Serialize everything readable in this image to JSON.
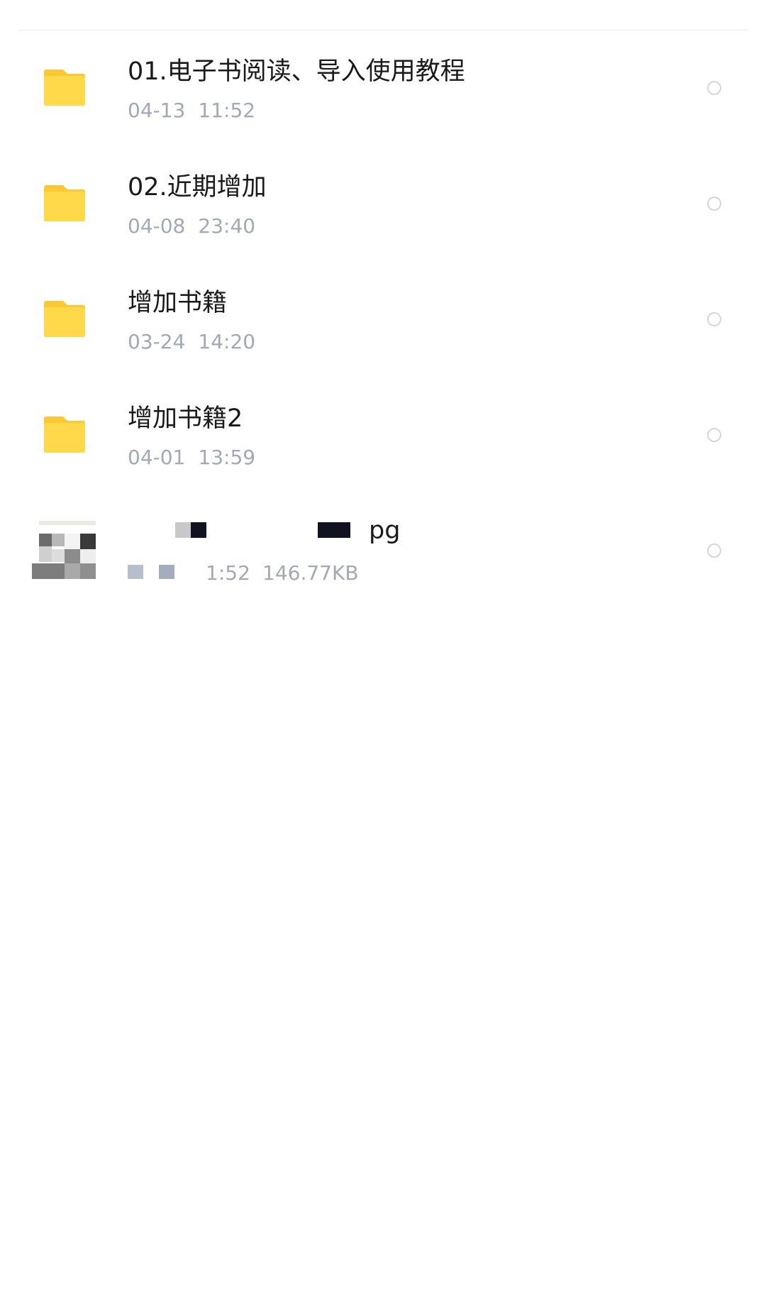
{
  "colors": {
    "folder": "#FFD94A",
    "folder_tab": "#F9C834",
    "name_text": "#1a1a1a",
    "meta_text": "#a3a8b2",
    "radio_border": "#d6d6d6"
  },
  "files": [
    {
      "type": "folder",
      "icon": "folder-icon",
      "name": "01.电子书阅读、导入使用教程",
      "date": "04-13",
      "time": "11:52",
      "size": ""
    },
    {
      "type": "folder",
      "icon": "folder-icon",
      "name": "02.近期增加",
      "date": "04-08",
      "time": "23:40",
      "size": ""
    },
    {
      "type": "folder",
      "icon": "folder-icon",
      "name": "增加书籍",
      "date": "03-24",
      "time": "14:20",
      "size": ""
    },
    {
      "type": "folder",
      "icon": "folder-icon",
      "name": "增加书籍2",
      "date": "04-01",
      "time": "13:59",
      "size": ""
    },
    {
      "type": "image",
      "icon": "image-thumbnail",
      "name_visible_suffix": "pg",
      "time_visible": "1:52",
      "size": "146.77KB"
    }
  ]
}
